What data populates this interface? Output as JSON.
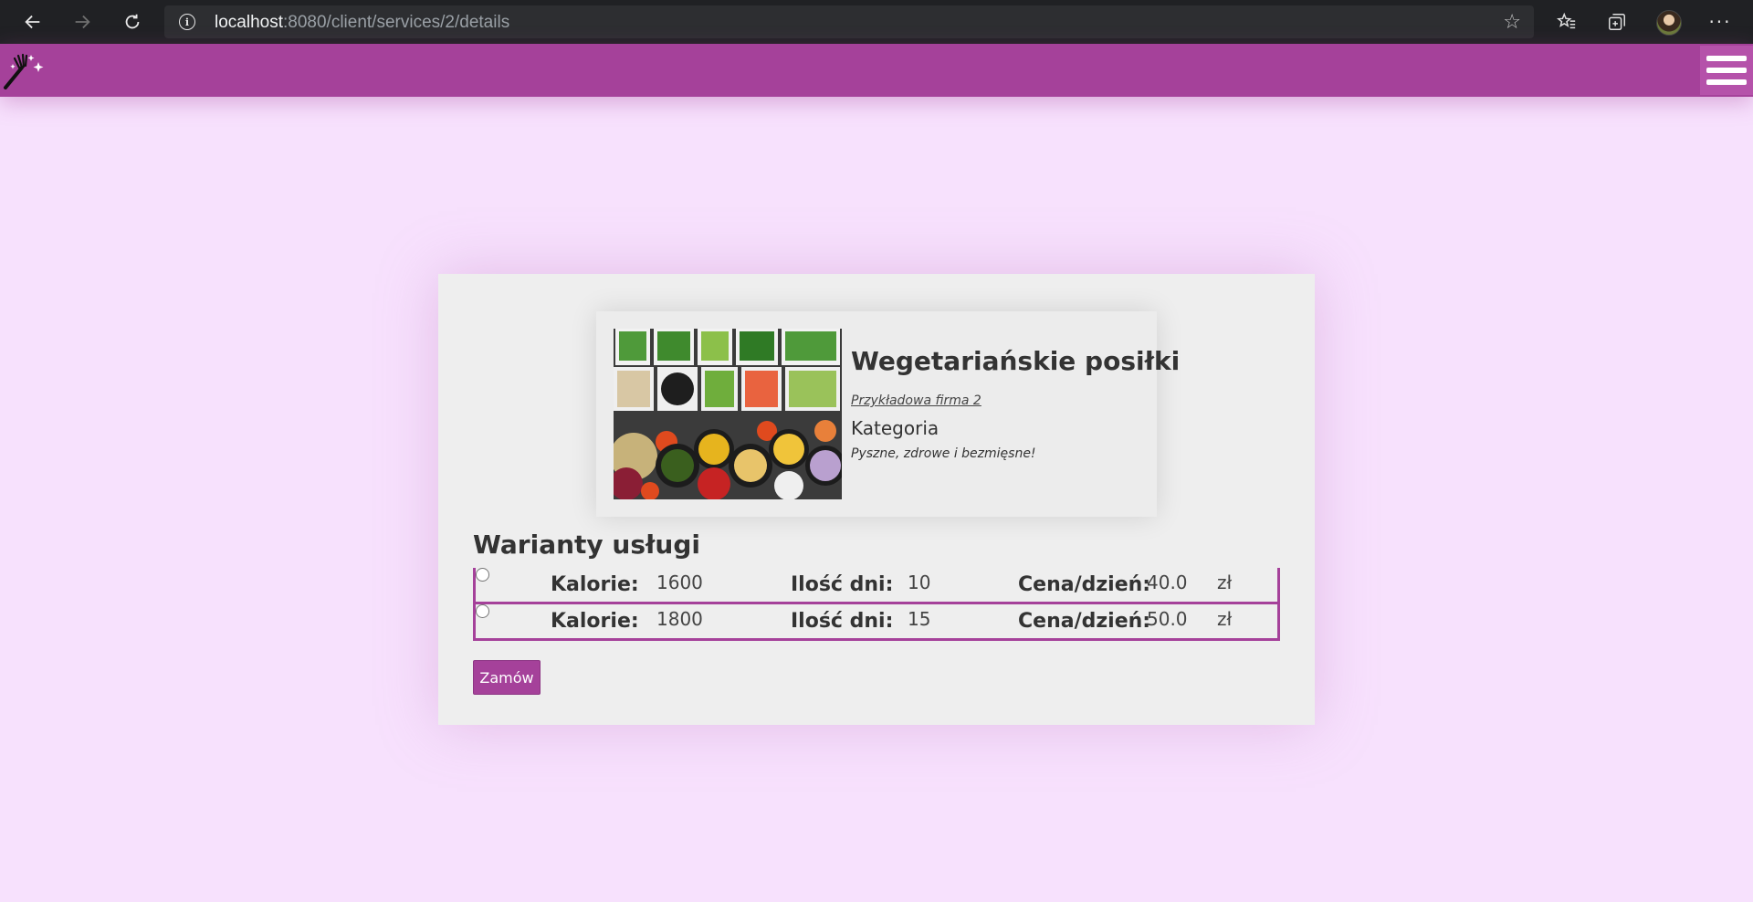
{
  "browser": {
    "url_host": "localhost",
    "url_path": ":8080/client/services/2/details"
  },
  "service": {
    "title": "Wegetariańskie posiłki",
    "company": "Przykładowa firma 2",
    "category": "Kategoria",
    "description": "Pyszne, zdrowe i bezmięsne!"
  },
  "variants": {
    "heading": "Warianty usługi",
    "items": [
      {
        "calories_label": "Kalorie:",
        "calories": "1600",
        "days_label": "Ilość dni:",
        "days": "10",
        "price_label": "Cena/dzień:",
        "price": "40.0",
        "currency": "zł"
      },
      {
        "calories_label": "Kalorie:",
        "calories": "1800",
        "days_label": "Ilość dni:",
        "days": "15",
        "price_label": "Cena/dzień:",
        "price": "50.0",
        "currency": "zł"
      }
    ]
  },
  "order_button": "Zamów",
  "colors": {
    "accent": "#a5419a",
    "page_background": "#f7e1fd",
    "panel_background": "#eeeeee"
  },
  "icons": [
    "back-icon",
    "forward-icon",
    "reload-icon",
    "info-icon",
    "star-icon",
    "favorites-icon",
    "collections-icon",
    "profile-avatar",
    "more-icon",
    "fork-wand-logo",
    "hamburger-menu-icon"
  ]
}
